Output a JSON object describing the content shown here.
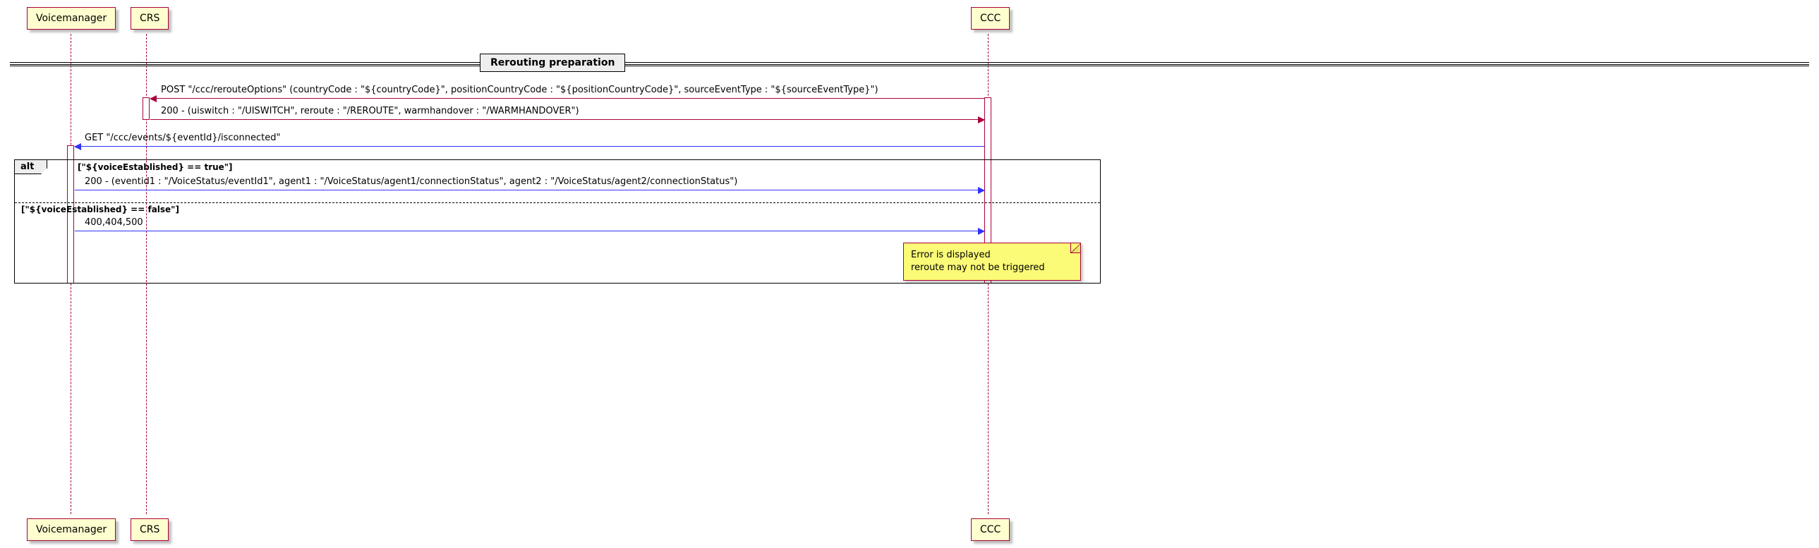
{
  "participants": {
    "voicemanager": "Voicemanager",
    "crs": "CRS",
    "ccc": "CCC"
  },
  "divider": "Rerouting preparation",
  "msg1": "POST \"/ccc/rerouteOptions\" (countryCode : \"${countryCode}\", positionCountryCode : \"${positionCountryCode}\", sourceEventType : \"${sourceEventType}\")",
  "msg2": "200 - (uiswitch : \"/UISWITCH\", reroute : \"/REROUTE\", warmhandover : \"/WARMHANDOVER\")",
  "msg3": "GET \"/ccc/events/${eventId}/isconnected\"",
  "frame_tag": "alt",
  "guard1": "[\"${voiceEstablished} == true\"]",
  "msg4": "200 - (eventid1 : \"/VoiceStatus/eventId1\", agent1 : \"/VoiceStatus/agent1/connectionStatus\", agent2 : \"/VoiceStatus/agent2/connectionStatus\")",
  "guard2": "[\"${voiceEstablished} == false\"]",
  "msg5": "400,404,500",
  "note": {
    "line1": "Error is displayed",
    "line2": " reroute may not be triggered"
  },
  "colors": {
    "request": "#a80036",
    "reply": "#3030ff"
  }
}
